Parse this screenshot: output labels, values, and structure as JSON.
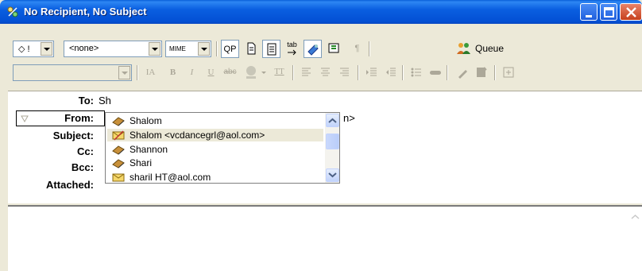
{
  "window": {
    "title": "No Recipient, No Subject"
  },
  "toolbar": {
    "priority_value": "◇ !",
    "stationery_value": "<none>",
    "mime_value": "MIME",
    "qp_label": "QP",
    "tab_label": "tab",
    "queue_label": "Queue",
    "format": {
      "bold": "B",
      "italic": "I",
      "underline": "U",
      "strike": "abc",
      "tt": "TT",
      "ia": "IA",
      "para": "¶"
    }
  },
  "header": {
    "to_label": "To:",
    "to_value": "Sh",
    "from_label": "From:",
    "from_value_tail": "n>",
    "subject_label": "Subject:",
    "cc_label": "Cc:",
    "bcc_label": "Bcc:",
    "attached_label": "Attached:"
  },
  "autocomplete": {
    "items": [
      {
        "text": "Shalom",
        "icon": "address-book-icon",
        "selected": false
      },
      {
        "text": "Shalom <vcdancegrl@aol.com>",
        "icon": "envelope-icon",
        "selected": true
      },
      {
        "text": "Shannon",
        "icon": "address-book-icon",
        "selected": false
      },
      {
        "text": "Shari",
        "icon": "address-book-icon",
        "selected": false
      },
      {
        "text": "sharil HT@aol.com",
        "icon": "envelope-icon",
        "selected": false
      }
    ]
  },
  "colors": {
    "titlebar": "#0a5fe0",
    "accent": "#0350d4",
    "face": "#ece9d8"
  }
}
